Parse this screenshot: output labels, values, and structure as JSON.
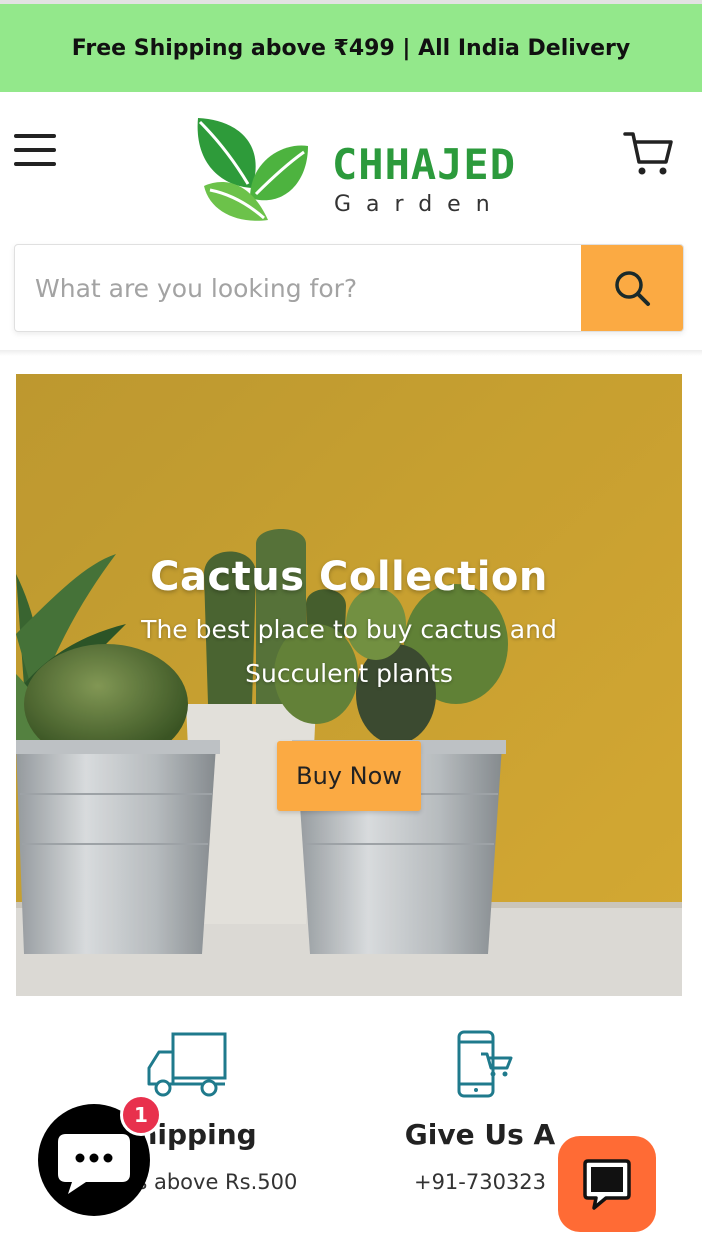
{
  "announcement": {
    "text": "Free Shipping above ₹499 | All India Delivery"
  },
  "header": {
    "logo": {
      "brand": "CHHAJED",
      "sub": "Garden"
    },
    "menu_icon": "hamburger-icon",
    "cart_icon": "cart-icon"
  },
  "search": {
    "placeholder": "What are you looking for?",
    "value": "",
    "icon": "search-icon"
  },
  "hero": {
    "title": "Cactus Collection",
    "subtitle": "The best place to buy cactus and Succulent plants",
    "cta_label": "Buy Now"
  },
  "features": [
    {
      "icon": "delivery-truck-icon",
      "title": "Shipping",
      "text": "Orders above Rs.500"
    },
    {
      "icon": "phone-cart-icon",
      "title": "Give Us A",
      "text": "+91-730323"
    }
  ],
  "chat": {
    "badge_count": "1",
    "icon": "chat-icon"
  },
  "help": {
    "icon": "help-chat-icon"
  },
  "colors": {
    "announcement_bg": "#93e88b",
    "accent": "#fbaa43",
    "brand_green": "#2c9a3c",
    "icon_teal": "#1f7a8c",
    "chat_badge": "#e8314d",
    "help_button": "#ff6b35"
  }
}
